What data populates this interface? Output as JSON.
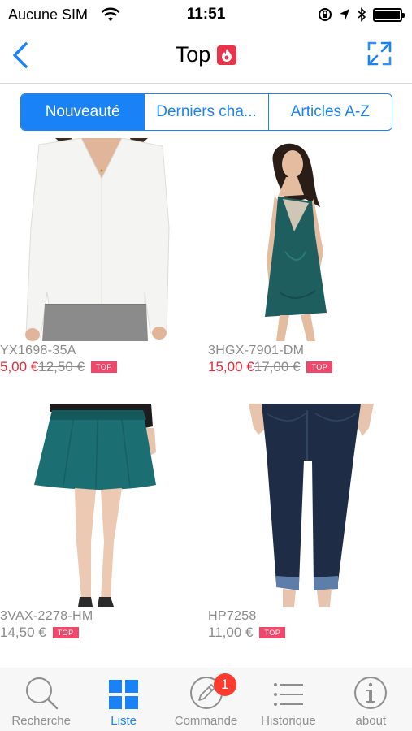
{
  "status_bar": {
    "carrier": "Aucune SIM",
    "time": "11:51"
  },
  "nav": {
    "title": "Top"
  },
  "segments": [
    {
      "label": "Nouveauté",
      "active": true
    },
    {
      "label": "Derniers cha...",
      "active": false
    },
    {
      "label": "Articles A-Z",
      "active": false
    }
  ],
  "products": [
    {
      "code": "YX1698-35A",
      "price": "5,00 €",
      "old_price": "12,50 €",
      "badge": "TOP"
    },
    {
      "code": "3HGX-7901-DM",
      "price": "15,00 €",
      "old_price": "17,00 €",
      "badge": "TOP"
    },
    {
      "code": "3VAX-2278-HM",
      "price": "14,50 €",
      "old_price": "",
      "badge": "TOP"
    },
    {
      "code": "HP7258",
      "price": "11,00 €",
      "old_price": "",
      "badge": "TOP"
    }
  ],
  "tab_bar": {
    "items": [
      {
        "label": "Recherche",
        "icon": "search-icon",
        "active": false
      },
      {
        "label": "Liste",
        "icon": "grid-icon",
        "active": true
      },
      {
        "label": "Commande",
        "icon": "pencil-icon",
        "active": false,
        "badge": "1"
      },
      {
        "label": "Historique",
        "icon": "list-icon",
        "active": false
      },
      {
        "label": "about",
        "icon": "info-icon",
        "active": false
      }
    ]
  },
  "colors": {
    "accent": "#1a82f7",
    "sale_price": "#e8283a",
    "badge": "#f0476a",
    "notification": "#ff3b30"
  }
}
